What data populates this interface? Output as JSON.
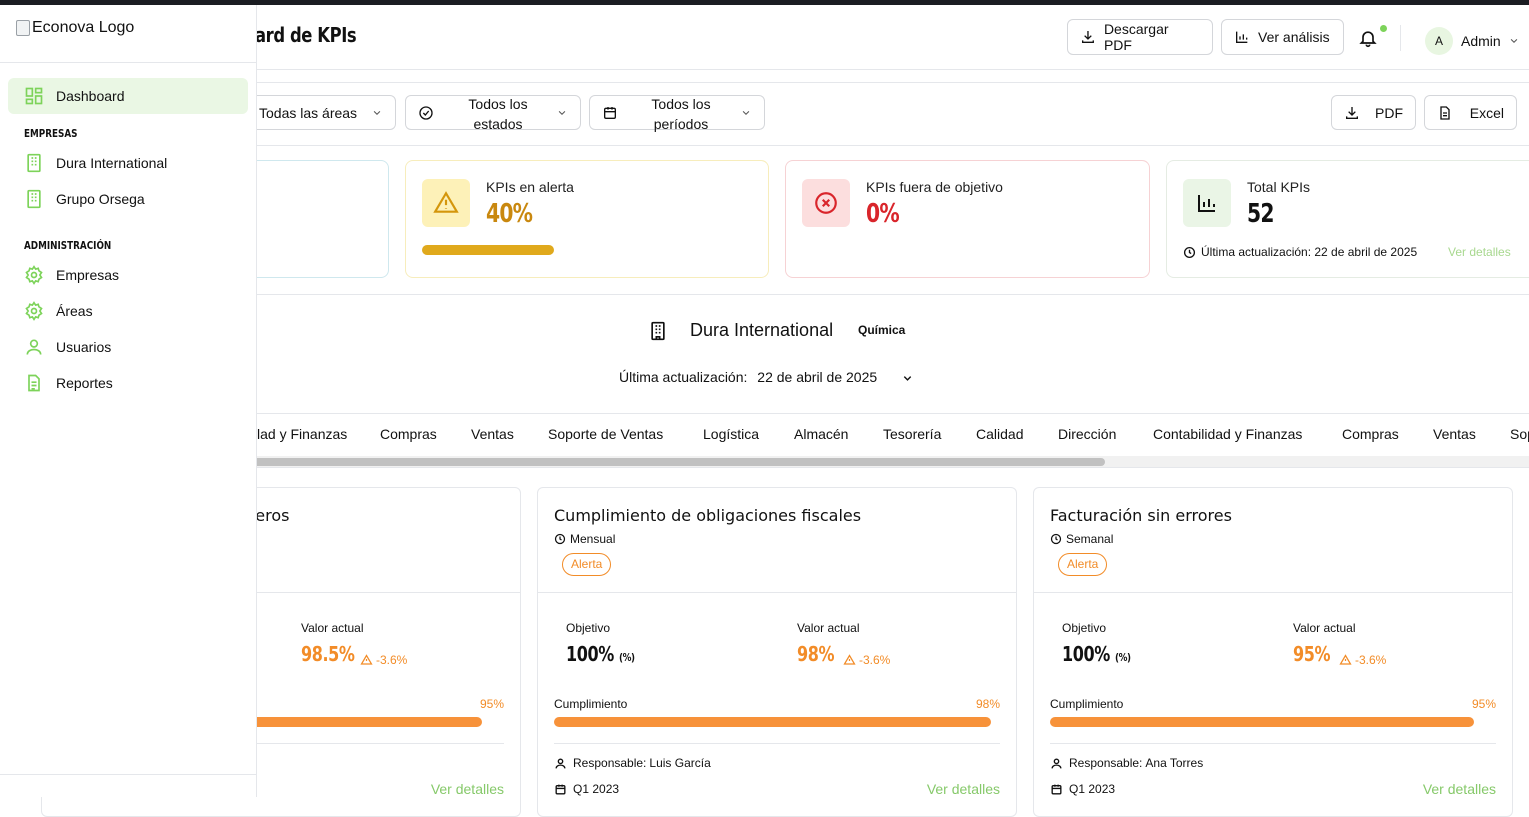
{
  "app": {
    "logo_alt": "Econova Logo",
    "page_title": "Dashboard de KPIs",
    "page_title_visible": "ard de KPIs"
  },
  "header": {
    "download_pdf": "Descargar PDF",
    "view_analysis": "Ver análisis",
    "user_initial": "A",
    "user_name": "Admin"
  },
  "filters": {
    "areas": "Todas las áreas",
    "states": "Todos los estados",
    "periods": "Todos los períodos",
    "export_pdf": "PDF",
    "export_excel": "Excel"
  },
  "stats": {
    "alert": {
      "label": "KPIs en alerta",
      "value": "40%",
      "progress": 0.4,
      "color": "#e0a91c"
    },
    "off_target": {
      "label": "KPIs fuera de objetivo",
      "value": "0%",
      "color": "#d9252b"
    },
    "total": {
      "label": "Total KPIs",
      "value": "52",
      "updated": "Última actualización: 22 de abril de 2025",
      "link": "Ver detalles"
    }
  },
  "company": {
    "name": "Dura International",
    "industry": "Química",
    "update_label": "Última actualización:",
    "update_value": "22 de abril de 2025"
  },
  "tabs": [
    "lad y Finanzas",
    "Compras",
    "Ventas",
    "Soporte de Ventas",
    "Logística",
    "Almacén",
    "Tesorería",
    "Calidad",
    "Dirección",
    "Contabilidad y Finanzas",
    "Compras",
    "Ventas",
    "Sop"
  ],
  "kpis": [
    {
      "title": "cieros",
      "actual_label": "Valor actual",
      "actual": "98.5%",
      "delta": "-3.6%",
      "percent": "95%",
      "progress": 0.95,
      "link": "Ver detalles"
    },
    {
      "title": "Cumplimiento de obligaciones fiscales",
      "frequency": "Mensual",
      "badge": "Alerta",
      "target_label": "Objetivo",
      "target": "100%",
      "target_unit": "(%)",
      "actual_label": "Valor actual",
      "actual": "98%",
      "delta": "-3.6%",
      "compliance_label": "Cumplimiento",
      "percent": "98%",
      "progress": 0.98,
      "responsible_label": "Responsable:",
      "responsible": "Luis García",
      "period": "Q1 2023",
      "link": "Ver detalles"
    },
    {
      "title": "Facturación sin errores",
      "frequency": "Semanal",
      "badge": "Alerta",
      "target_label": "Objetivo",
      "target": "100%",
      "target_unit": "(%)",
      "actual_label": "Valor actual",
      "actual": "95%",
      "delta": "-3.6%",
      "compliance_label": "Cumplimiento",
      "percent": "95%",
      "progress": 0.95,
      "responsible_label": "Responsable:",
      "responsible": "Ana Torres",
      "period": "Q1 2023",
      "link": "Ver detalles"
    }
  ],
  "sidebar": {
    "dashboard": "Dashboard",
    "section_companies": "EMPRESAS",
    "companies": [
      "Dura International",
      "Grupo Orsega"
    ],
    "section_admin": "ADMINISTRACIÓN",
    "admin_items": [
      "Empresas",
      "Áreas",
      "Usuarios",
      "Reportes"
    ]
  },
  "colors": {
    "accent_green": "#7dd35a",
    "alert_orange": "#f28c28",
    "danger_red": "#d9252b"
  }
}
